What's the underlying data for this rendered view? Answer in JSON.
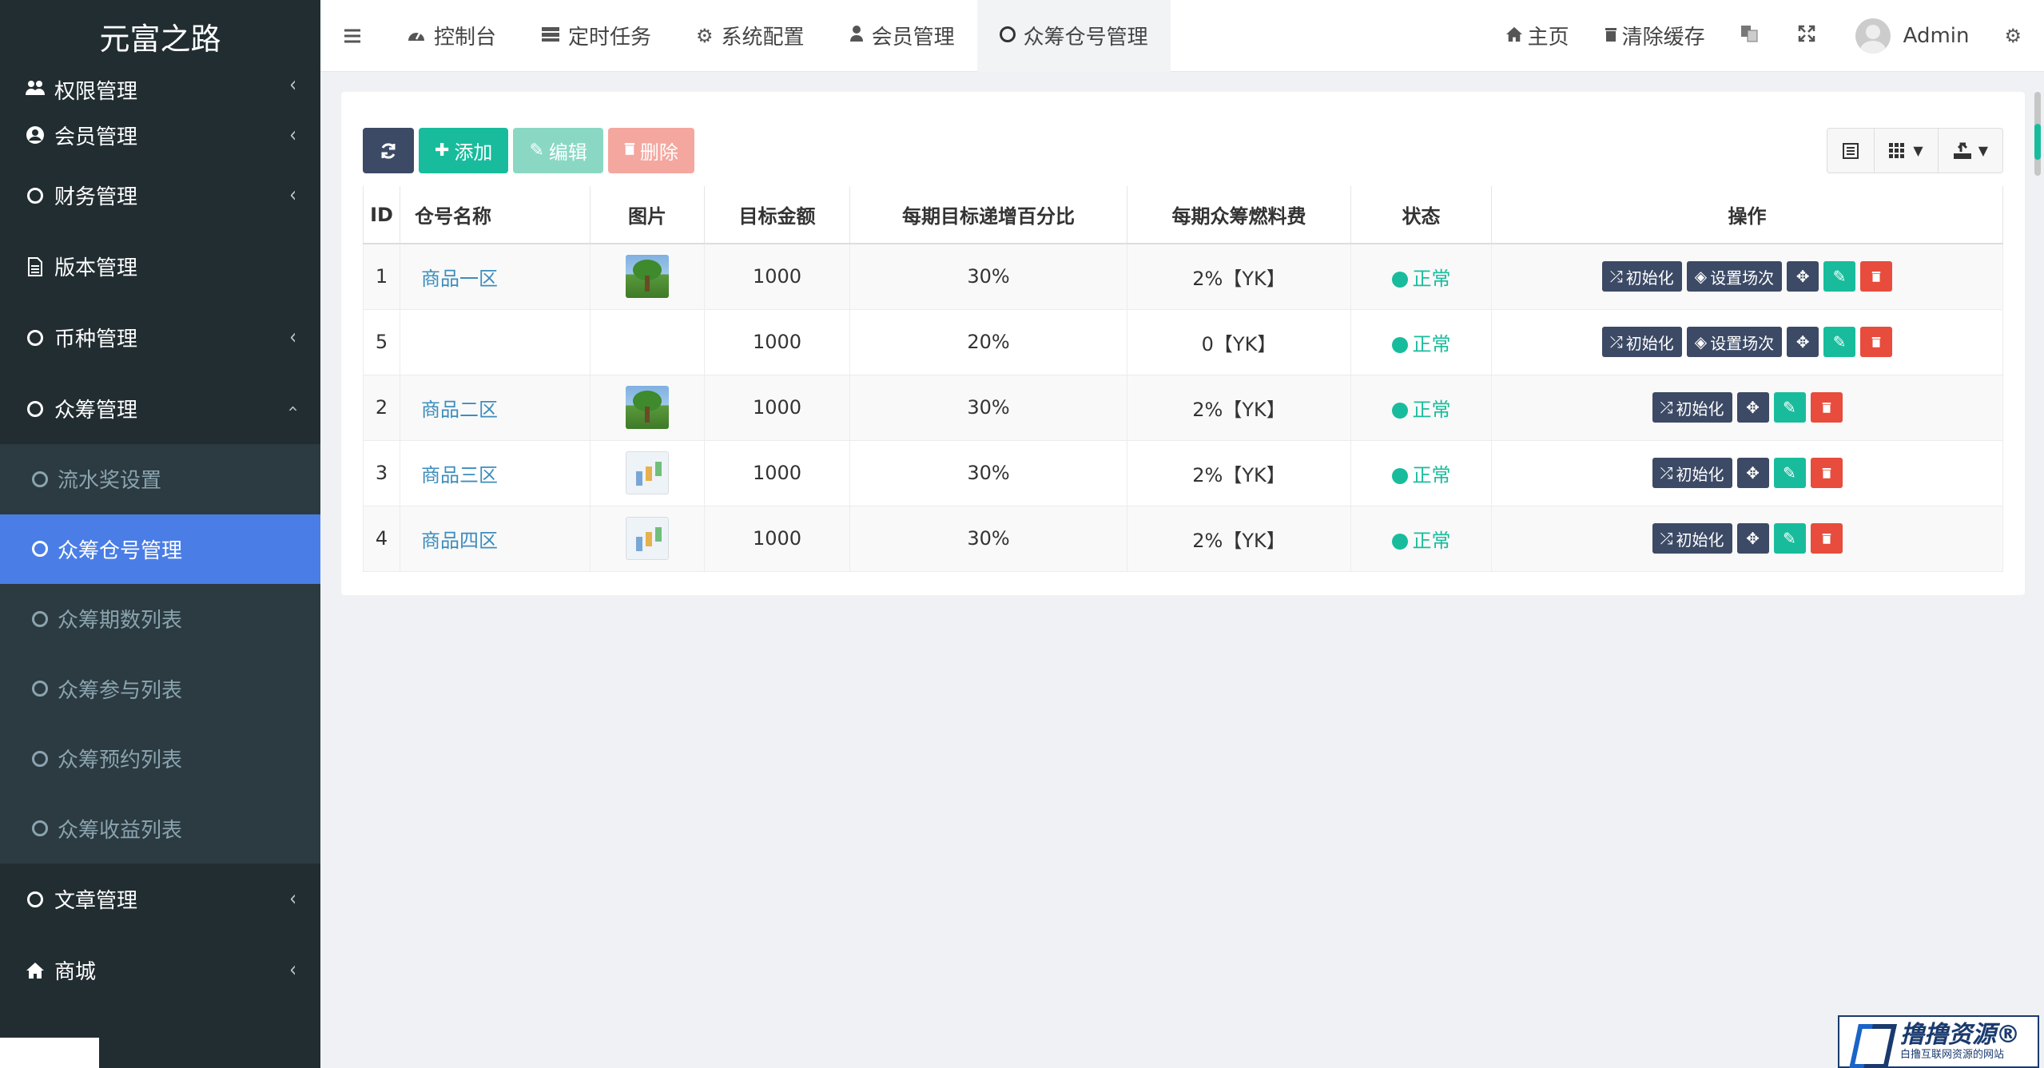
{
  "sidebar": {
    "logo": "元富之路",
    "items": [
      {
        "label": "权限管理",
        "icon": "users-icon"
      },
      {
        "label": "会员管理",
        "icon": "user-circle-icon"
      },
      {
        "label": "财务管理",
        "icon": "circle-icon"
      },
      {
        "label": "版本管理",
        "icon": "file-icon"
      },
      {
        "label": "币种管理",
        "icon": "circle-icon"
      },
      {
        "label": "众筹管理",
        "icon": "circle-icon"
      }
    ],
    "subitems": [
      {
        "label": "流水奖设置"
      },
      {
        "label": "众筹仓号管理"
      },
      {
        "label": "众筹期数列表"
      },
      {
        "label": "众筹参与列表"
      },
      {
        "label": "众筹预约列表"
      },
      {
        "label": "众筹收益列表"
      }
    ],
    "bottom_items": [
      {
        "label": "文章管理",
        "icon": "circle-icon"
      },
      {
        "label": "商城",
        "icon": "home-icon"
      }
    ]
  },
  "topbar": {
    "tabs": [
      {
        "label": "控制台",
        "icon": "dashboard-icon"
      },
      {
        "label": "定时任务",
        "icon": "tasks-icon"
      },
      {
        "label": "系统配置",
        "icon": "cog-icon"
      },
      {
        "label": "会员管理",
        "icon": "user-icon"
      },
      {
        "label": "众筹仓号管理",
        "icon": "circle-icon"
      }
    ],
    "home": "主页",
    "clear_cache": "清除缓存",
    "user": "Admin"
  },
  "toolbar": {
    "add": "添加",
    "edit": "编辑",
    "delete": "删除"
  },
  "table": {
    "headers": [
      "ID",
      "仓号名称",
      "图片",
      "目标金额",
      "每期目标递增百分比",
      "每期众筹燃料费",
      "状态",
      "操作"
    ],
    "rows": [
      {
        "id": "1",
        "name": "商品一区",
        "image": "tree",
        "target": "1000",
        "pct": "30%",
        "fee": "2%【YK】",
        "status": "正常",
        "set_label": true
      },
      {
        "id": "5",
        "name": "",
        "image": "",
        "target": "1000",
        "pct": "20%",
        "fee": "0【YK】",
        "status": "正常",
        "set_label": true
      },
      {
        "id": "2",
        "name": "商品二区",
        "image": "tree",
        "target": "1000",
        "pct": "30%",
        "fee": "2%【YK】",
        "status": "正常",
        "set_label": false
      },
      {
        "id": "3",
        "name": "商品三区",
        "image": "chart",
        "target": "1000",
        "pct": "30%",
        "fee": "2%【YK】",
        "status": "正常",
        "set_label": false
      },
      {
        "id": "4",
        "name": "商品四区",
        "image": "chart",
        "target": "1000",
        "pct": "30%",
        "fee": "2%【YK】",
        "status": "正常",
        "set_label": false
      }
    ],
    "actions": {
      "init": "初始化",
      "set_rounds": "设置场次"
    }
  },
  "watermark": {
    "main": "撸撸资源®",
    "sub": "白撸互联网资源的网站"
  },
  "colors": {
    "sidebar_bg": "#222d32",
    "active_blue": "#4a7ee6",
    "success": "#18bc9c",
    "danger": "#e74c3c",
    "dark_btn": "#3c4a66",
    "link": "#3c8dbc"
  }
}
